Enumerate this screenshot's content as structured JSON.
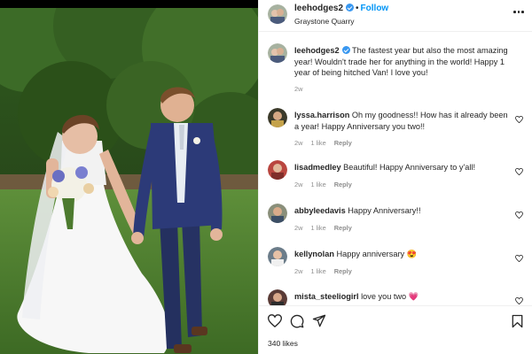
{
  "post": {
    "author": "leehodges2",
    "follow_label": "Follow",
    "location": "Graystone Quarry",
    "caption_text": "The fastest year but also the most amazing year! Wouldn't trade her for anything in the world! Happy 1 year of being hitched Van! I love you!",
    "caption_time": "2w",
    "likes": "340 likes"
  },
  "comments": [
    {
      "user": "lyssa.harrison",
      "text": "Oh my goodness!! How has it already been a year! Happy Anniversary you two!!",
      "time": "2w",
      "likes": "1 like",
      "reply": "Reply"
    },
    {
      "user": "lisadmedley",
      "text": "Beautiful! Happy Anniversary to y'all!",
      "time": "2w",
      "likes": "1 like",
      "reply": "Reply"
    },
    {
      "user": "abbyleedavis",
      "text": "Happy Anniversary!!",
      "time": "2w",
      "likes": "1 like",
      "reply": "Reply"
    },
    {
      "user": "kellynolan",
      "text": "Happy anniversary 😍",
      "time": "2w",
      "likes": "1 like",
      "reply": "Reply"
    },
    {
      "user": "mista_steeliogirl",
      "text": "love you two 💗",
      "time": "",
      "likes": "",
      "reply": ""
    }
  ],
  "icons": {
    "verified": "verified-badge-icon",
    "more": "more-options-icon",
    "like": "heart-icon",
    "comment": "comment-icon",
    "share": "share-icon",
    "save": "bookmark-icon"
  },
  "colors": {
    "accent": "#0095f6",
    "verified": "#3897f0",
    "text": "#262626",
    "muted": "#8e8e8e"
  }
}
